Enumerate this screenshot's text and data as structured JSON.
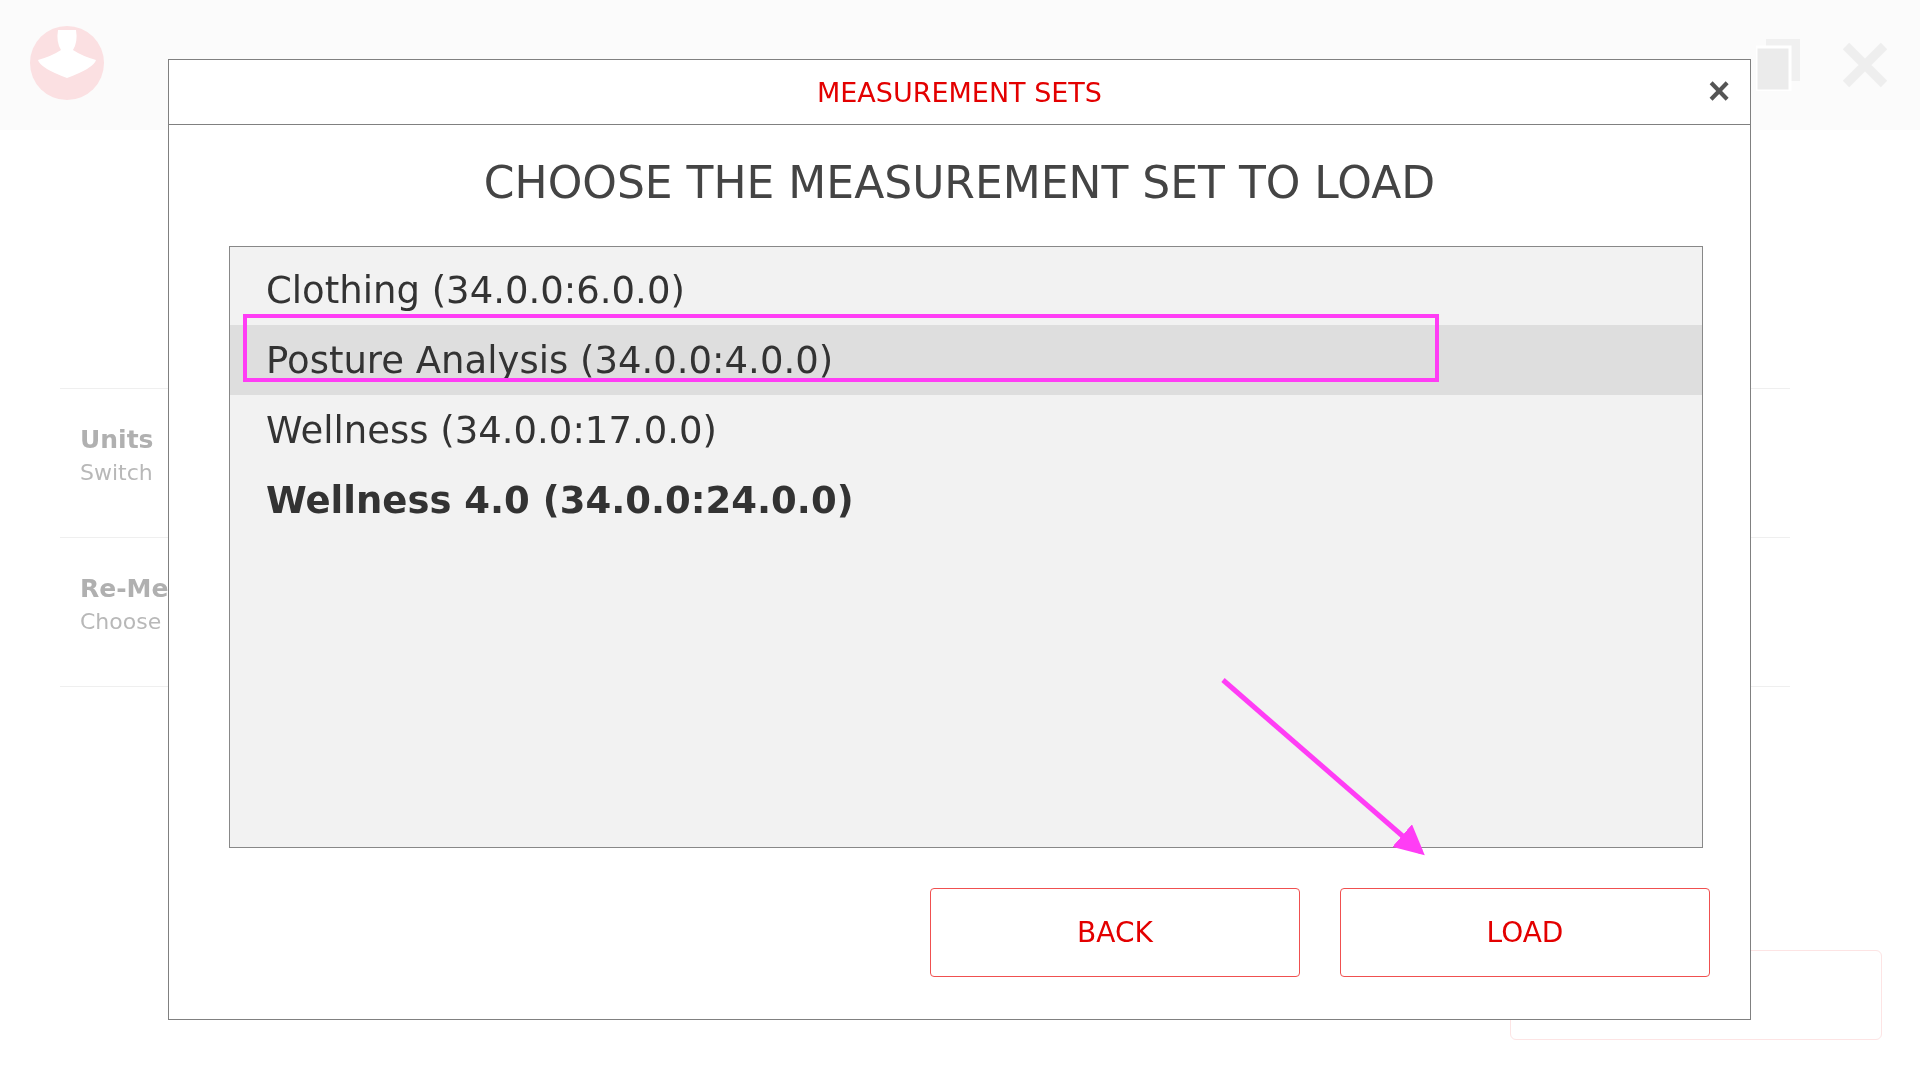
{
  "background": {
    "items": [
      {
        "label": "Units",
        "description": "Switch"
      },
      {
        "label": "Re-Me",
        "description": "Choose"
      }
    ]
  },
  "dialog": {
    "title": "MEASUREMENT SETS",
    "close": "×",
    "heading": "CHOOSE THE MEASUREMENT SET TO LOAD",
    "sets": [
      {
        "label": "Clothing (34.0.0:6.0.0)",
        "selected": false,
        "bold": false
      },
      {
        "label": "Posture Analysis (34.0.0:4.0.0)",
        "selected": true,
        "bold": false
      },
      {
        "label": "Wellness (34.0.0:17.0.0)",
        "selected": false,
        "bold": false
      },
      {
        "label": "Wellness 4.0 (34.0.0:24.0.0)",
        "selected": false,
        "bold": true
      }
    ],
    "buttons": [
      "BACK",
      "LOAD"
    ]
  }
}
